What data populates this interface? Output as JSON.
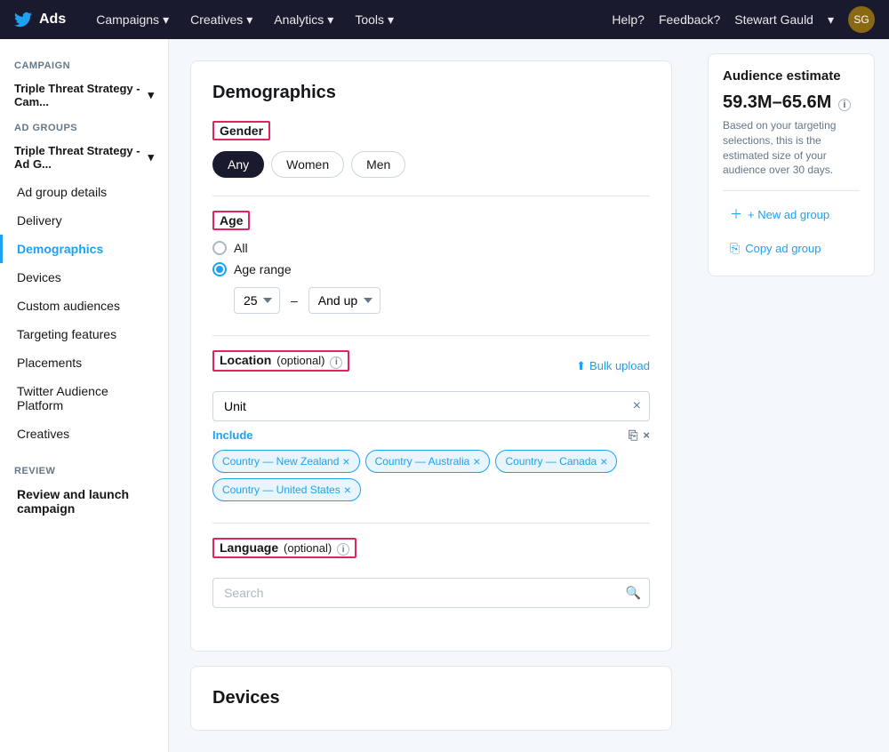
{
  "topnav": {
    "logo_text": "Ads",
    "links": [
      {
        "label": "Campaigns",
        "id": "campaigns"
      },
      {
        "label": "Creatives",
        "id": "creatives-nav"
      },
      {
        "label": "Analytics",
        "id": "analytics"
      },
      {
        "label": "Tools",
        "id": "tools"
      }
    ],
    "help": "Help?",
    "feedback": "Feedback?",
    "user": "Stewart Gauld"
  },
  "sidebar": {
    "campaign_label": "CAMPAIGN",
    "campaign_name": "Triple Threat Strategy - Cam...",
    "adgroups_label": "AD GROUPS",
    "adgroup_name": "Triple Threat Strategy - Ad G...",
    "items": [
      {
        "label": "Ad group details",
        "id": "ad-group-details",
        "active": false
      },
      {
        "label": "Delivery",
        "id": "delivery"
      },
      {
        "label": "Demographics",
        "id": "demographics-nav"
      },
      {
        "label": "Devices",
        "id": "devices-nav"
      },
      {
        "label": "Custom audiences",
        "id": "custom-audiences"
      },
      {
        "label": "Targeting features",
        "id": "targeting-features"
      },
      {
        "label": "Placements",
        "id": "placements"
      },
      {
        "label": "Twitter Audience Platform",
        "id": "twitter-audience-platform"
      },
      {
        "label": "Creatives",
        "id": "creatives"
      }
    ],
    "review_label": "REVIEW",
    "review_item": "Review and launch campaign"
  },
  "main": {
    "section_title": "Demographics",
    "gender": {
      "label": "Gender",
      "options": [
        {
          "label": "Any",
          "active": true
        },
        {
          "label": "Women",
          "active": false
        },
        {
          "label": "Men",
          "active": false
        }
      ]
    },
    "age": {
      "label": "Age",
      "options": [
        {
          "label": "All",
          "selected": false
        },
        {
          "label": "Age range",
          "selected": true
        }
      ],
      "from": "25",
      "to_label": "And up",
      "dash": "–"
    },
    "location": {
      "label": "Location",
      "optional": "(optional)",
      "bulk_upload": "Bulk upload",
      "search_value": "Unit",
      "include_label": "Include",
      "tags": [
        "Country — New Zealand",
        "Country — Australia",
        "Country — Canada",
        "Country — United States"
      ]
    },
    "language": {
      "label": "Language",
      "optional": "(optional)",
      "search_placeholder": "Search"
    },
    "devices_title": "Devices"
  },
  "audience": {
    "title": "Audience estimate",
    "range": "59.3M–65.6M",
    "description": "Based on your targeting selections, this is the estimated size of your audience over 30 days.",
    "new_ad_group": "+ New ad group",
    "copy_ad_group": "Copy ad group"
  }
}
